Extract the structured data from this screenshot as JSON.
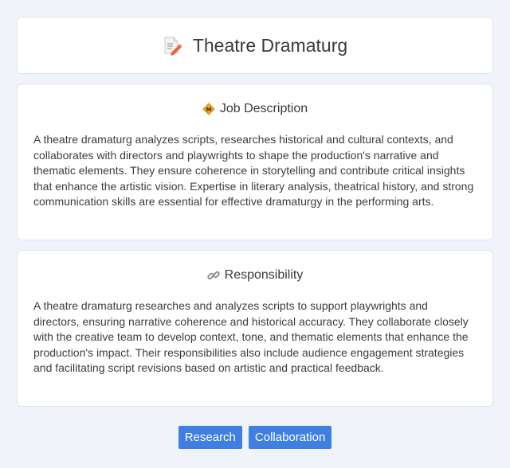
{
  "header": {
    "title": "Theatre Dramaturg",
    "icon": "memo-pencil-icon"
  },
  "job_description": {
    "heading": "Job Description",
    "icon": "diamond-sign-icon",
    "body": "A theatre dramaturg analyzes scripts, researches historical and cultural contexts, and collaborates with directors and playwrights to shape the production's narrative and thematic elements. They ensure coherence in storytelling and contribute critical insights that enhance the artistic vision. Expertise in literary analysis, theatrical history, and strong communication skills are essential for effective dramaturgy in the performing arts."
  },
  "responsibility": {
    "heading": "Responsibility",
    "icon": "link-icon",
    "body": "A theatre dramaturg researches and analyzes scripts to support playwrights and directors, ensuring narrative coherence and historical accuracy. They collaborate closely with the creative team to develop context, tone, and thematic elements that enhance the production's impact. Their responsibilities also include audience engagement strategies and facilitating script revisions based on artistic and practical feedback."
  },
  "tags": [
    "Research",
    "Collaboration"
  ],
  "colors": {
    "background": "#f0f3f9",
    "tag": "#3f7fe0"
  }
}
